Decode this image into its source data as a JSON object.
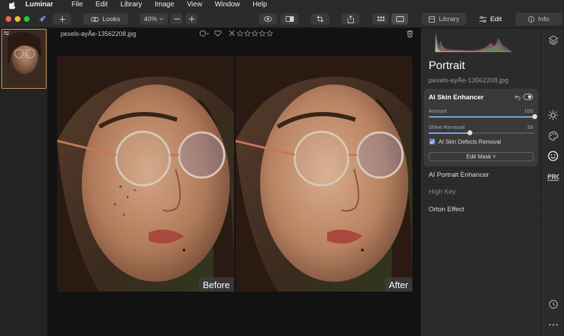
{
  "menubar": {
    "app_name": "Luminar",
    "items": [
      "File",
      "Edit",
      "Library",
      "Image",
      "View",
      "Window",
      "Help"
    ]
  },
  "toolbar": {
    "looks_label": "Looks",
    "zoom_value": "40%",
    "tabs": [
      {
        "label": "Library",
        "icon": "library-icon",
        "active": false
      },
      {
        "label": "Edit",
        "icon": "sliders-icon",
        "active": true
      },
      {
        "label": "Info",
        "icon": "info-icon",
        "active": false
      }
    ]
  },
  "view": {
    "before_label": "Before",
    "after_label": "After",
    "filename": "pexels-ayÅe-13562208.jpg"
  },
  "panel": {
    "title": "Portrait",
    "filename": "pexels-ayÅe-13562208.jpg",
    "tool": {
      "name": "AI Skin Enhancer",
      "sliders": [
        {
          "label": "Amount",
          "value": "100",
          "level": 100
        },
        {
          "label": "Shine Removal",
          "value": "39",
          "level": 39
        }
      ],
      "checkbox_label": "AI Skin Defects Removal",
      "checkbox_checked": true,
      "edit_mask_label": "Edit Mask ˅"
    },
    "tools": [
      "AI Portrait Enhancer",
      "High Key",
      "Orton Effect"
    ],
    "tools_dim": [
      false,
      true,
      false
    ]
  },
  "rail": {
    "pro_label": "PRO",
    "icons": [
      "layers-icon",
      "sun-icon",
      "palette-icon",
      "smile-icon",
      "pro-badge",
      "history-icon",
      "more-icon"
    ]
  },
  "colors": {
    "accent": "#7aa8e8",
    "thumb_border": "#d0a050",
    "close": "#ff5f57",
    "minimize": "#febc2e",
    "zoom": "#28c840"
  }
}
